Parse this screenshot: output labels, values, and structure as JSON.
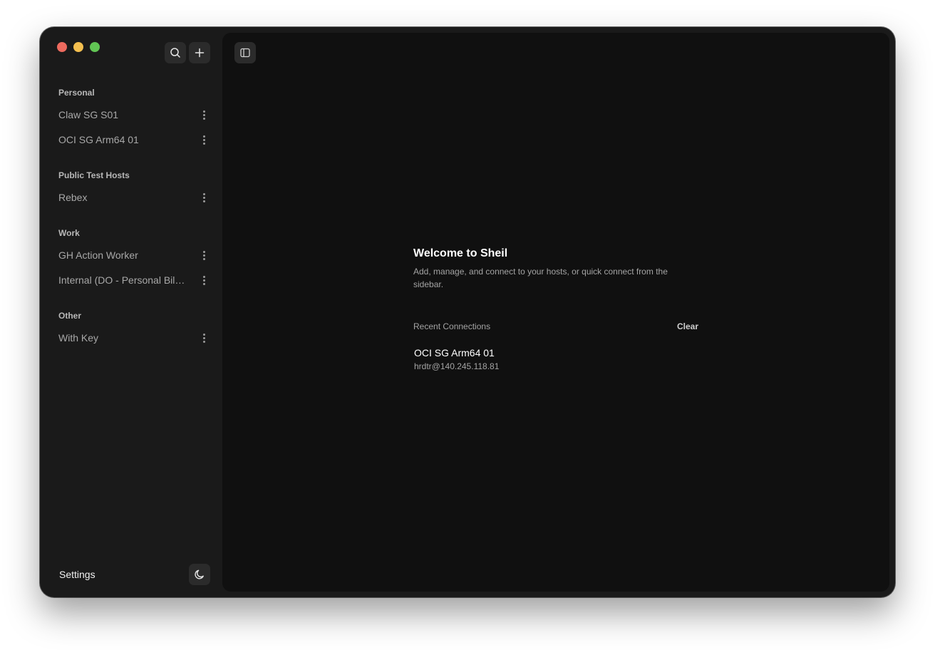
{
  "window": {
    "controls": [
      "close",
      "minimize",
      "zoom"
    ]
  },
  "sidebar": {
    "search_icon": "search-icon",
    "add_icon": "plus-icon",
    "groups": [
      {
        "title": "Personal",
        "hosts": [
          "Claw SG S01",
          "OCI SG Arm64 01"
        ]
      },
      {
        "title": "Public Test Hosts",
        "hosts": [
          "Rebex"
        ]
      },
      {
        "title": "Work",
        "hosts": [
          "GH Action Worker",
          "Internal (DO - Personal Billi..."
        ]
      },
      {
        "title": "Other",
        "hosts": [
          "With Key"
        ]
      }
    ],
    "footer": {
      "settings_label": "Settings",
      "theme_icon": "moon-icon"
    }
  },
  "main": {
    "toggle_sidebar_icon": "sidebar-toggle-icon",
    "welcome": {
      "title": "Welcome to Sheil",
      "description": "Add, manage, and connect to your hosts, or quick connect from the sidebar."
    },
    "recent": {
      "title": "Recent Connections",
      "clear_label": "Clear",
      "items": [
        {
          "name": "OCI SG Arm64 01",
          "address": "hrdtr@140.245.118.81"
        }
      ]
    }
  },
  "colors": {
    "sidebar_bg": "#1a1a1a",
    "main_bg": "#101010",
    "close": "#ed6a5e",
    "minimize": "#f4bf4f",
    "zoom": "#61c554"
  }
}
